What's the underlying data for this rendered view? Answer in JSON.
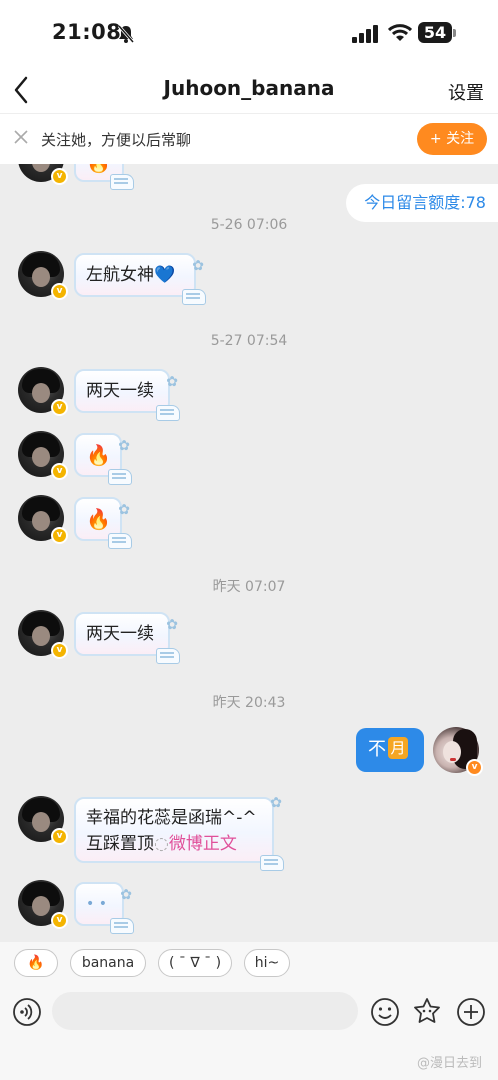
{
  "status_bar": {
    "time": "21:08",
    "battery": "54"
  },
  "nav": {
    "title": "Juhoon_banana",
    "settings": "设置"
  },
  "follow_bar": {
    "text": "关注她，方便以后常聊",
    "button": "+ 关注"
  },
  "quota": "今日留言额度:78",
  "timestamps": [
    "5-26 07:06",
    "5-27 07:54",
    "昨天 07:07",
    "昨天 20:43"
  ],
  "messages": {
    "m0": "🔥",
    "m1": "左航女神💙",
    "m2": "两天一续",
    "m3": "🔥",
    "m4": "🔥",
    "m5": "两天一续",
    "my_message": "不",
    "my_emoji": "月",
    "m6_line1": "幸福的花蕊是函瑞^-^",
    "m6_line2_prefix": "互踩置顶",
    "m6_line2_link": "微博正文",
    "m7": "• •"
  },
  "badge": "v",
  "quick_replies": [
    "🔥",
    "banana",
    "( ˉ ∇ ˉ )",
    "hi~"
  ],
  "input": {
    "placeholder": ""
  },
  "watermark": "@漫日去到",
  "colors": {
    "accent": "#2d8ae8",
    "follow": "#ff8a1f",
    "badge": "#f4b400",
    "link": "#e0509a"
  },
  "icons": [
    "bell-slash-icon",
    "signal-icon",
    "wifi-icon",
    "battery-icon",
    "back-icon",
    "close-icon",
    "voice-icon",
    "emoji-icon",
    "sticker-icon",
    "plus-icon"
  ]
}
